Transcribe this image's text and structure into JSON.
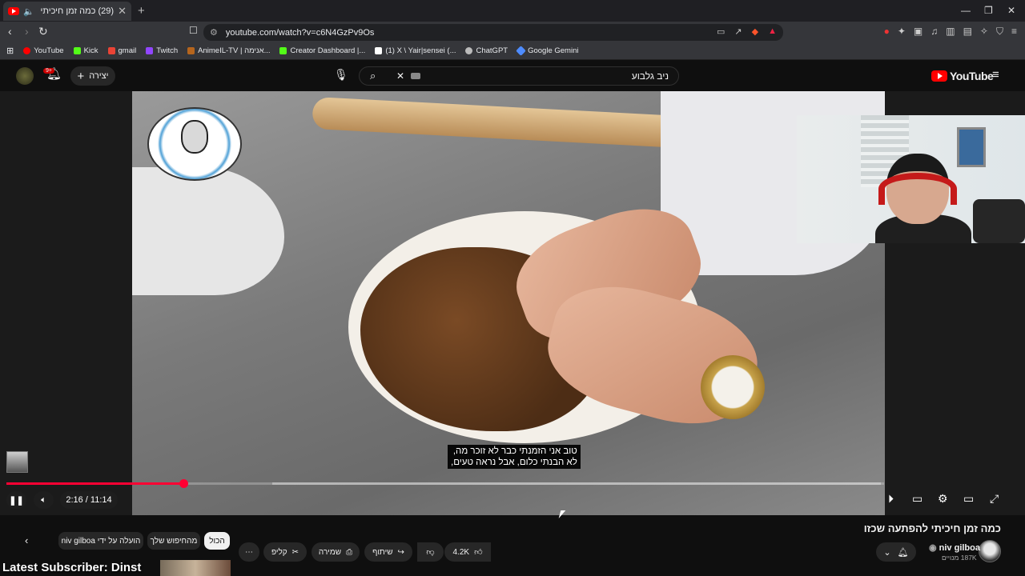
{
  "browser": {
    "tab_title": "(29) כמה זמן חיכיתי להפתעה שכזו",
    "url": "youtube.com/watch?v=c6N4GzPv9Os",
    "bookmarks": [
      {
        "label": "YouTube",
        "color": "#ff0000"
      },
      {
        "label": "Kick",
        "color": "#53fc18"
      },
      {
        "label": "gmail",
        "color": "#ea4335"
      },
      {
        "label": "Twitch",
        "color": "#9146ff"
      },
      {
        "label": "AnimeIL-TV | אנימה...",
        "color": "#b5651d"
      },
      {
        "label": "Creator Dashboard |...",
        "color": "#53fc18"
      },
      {
        "label": "(1) X \\ Yair|sensei (...",
        "color": "#ffffff"
      },
      {
        "label": "ChatGPT",
        "color": "#bbbbbb"
      },
      {
        "label": "Google Gemini",
        "color": "#4e8cff"
      }
    ]
  },
  "header": {
    "search_query": "ניב גלבוע",
    "create_label": "יצירה",
    "notification_count": "9+",
    "logo_text": "YouTube"
  },
  "player": {
    "subtitle": "טוב אני הזמנתי כבר לא זוכר מה,\nלא הבנתי כלום, אבל נראה טעים,",
    "time_display": "2:16 / 11:14",
    "progress_fraction": 0.2018
  },
  "below": {
    "video_title": "כמה זמן חיכיתי להפתעה שכזו",
    "channel_name": "niv gilboa",
    "subscribers": "187K מנויים",
    "like_count": "4.2K",
    "share_label": "שיתוף",
    "save_label": "שמירה",
    "clip_label": "קליפ",
    "chips": {
      "all": "הכול",
      "related": "מהחיפוש שלך",
      "uploaded_by": "הועלה על ידי niv gilboa"
    }
  },
  "overlay": {
    "latest_subscriber": "Latest Subscriber: Dinst"
  },
  "colors": {
    "accent": "#ff0033",
    "background": "#0f0f0f"
  }
}
